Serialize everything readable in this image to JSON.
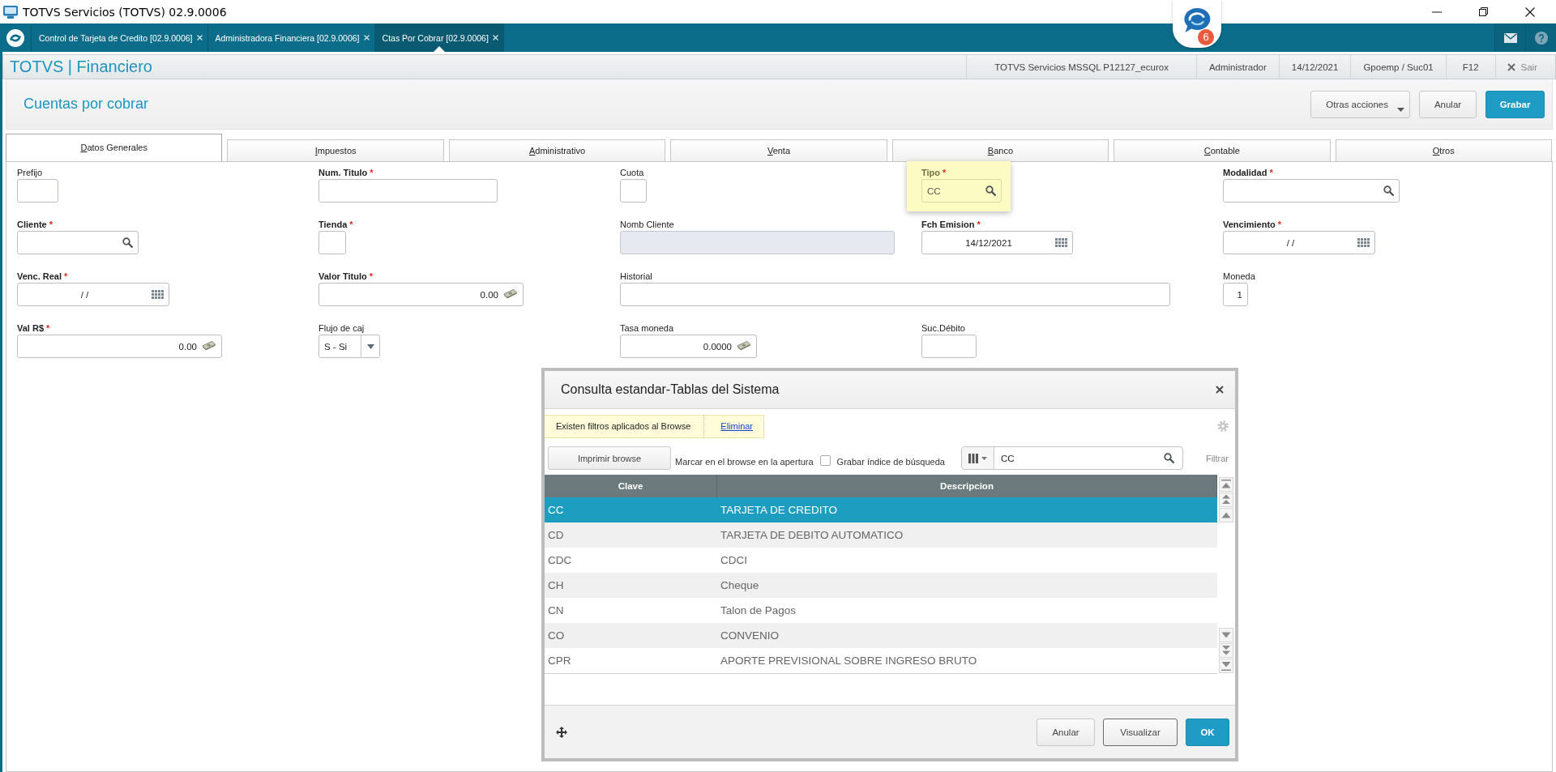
{
  "window": {
    "title": "TOTVS Servicios (TOTVS) 02.9.0006"
  },
  "app_tabs": [
    {
      "label": "Control de Tarjeta de Credito [02.9.0006]",
      "selected": false
    },
    {
      "label": "Administradora Financiera [02.9.0006]",
      "selected": false
    },
    {
      "label": "Ctas Por Cobrar [02.9.0006]",
      "selected": true
    }
  ],
  "chat": {
    "badge": "6"
  },
  "header": {
    "module": "TOTVS | Financiero",
    "environment": "TOTVS Servicios MSSQL P12127_ecurox",
    "user": "Administrador",
    "date": "14/12/2021",
    "branch": "Gpoemp / Suc01",
    "shortcut": "F12",
    "exit": "Sair"
  },
  "page": {
    "title": "Cuentas por cobrar",
    "actions": [
      {
        "label": "Otras acciones",
        "kind": "menu"
      },
      {
        "label": "Anular",
        "kind": "secondary"
      },
      {
        "label": "Grabar",
        "kind": "primary"
      }
    ]
  },
  "form_tabs": [
    {
      "label": "Datos Generales",
      "selected": true
    },
    {
      "label": "Impuestos",
      "selected": false
    },
    {
      "label": "Administrativo",
      "selected": false
    },
    {
      "label": "Venta",
      "selected": false
    },
    {
      "label": "Banco",
      "selected": false
    },
    {
      "label": "Contable",
      "selected": false
    },
    {
      "label": "Otros",
      "selected": false
    }
  ],
  "fields": [
    {
      "label": "Prefijo",
      "kind": "text",
      "disabled": false,
      "focused": false
    },
    {
      "label": "Num. Titulo",
      "required_mark": "*",
      "kind": "text",
      "disabled": false,
      "focused": false
    },
    {
      "label": "Cuota",
      "kind": "text",
      "disabled": false,
      "focused": false
    },
    {
      "label": "Tipo",
      "required_mark": "*",
      "kind": "lookup",
      "value": "CC",
      "disabled": false,
      "focused": true
    },
    {
      "label": "Modalidad",
      "required_mark": "*",
      "kind": "lookup",
      "disabled": false,
      "focused": false
    },
    {
      "label": "Cliente",
      "required_mark": "*",
      "kind": "lookup",
      "disabled": false,
      "focused": false
    },
    {
      "label": "Tienda",
      "required_mark": "*",
      "kind": "text",
      "disabled": false,
      "focused": false
    },
    {
      "label": "Nomb Cliente",
      "kind": "text",
      "disabled": true,
      "focused": false
    },
    {
      "label": "Fch Emision",
      "required_mark": "*",
      "kind": "date",
      "value": "14/12/2021",
      "disabled": false,
      "focused": false
    },
    {
      "label": "Vencimiento",
      "required_mark": "*",
      "kind": "date",
      "value": "/ /",
      "disabled": false,
      "focused": false
    },
    {
      "label": "Venc. Real",
      "required_mark": "*",
      "kind": "date",
      "value": "/ /",
      "disabled": false,
      "focused": false
    },
    {
      "label": "Valor Titulo",
      "required_mark": "*",
      "kind": "money",
      "value": "0.00",
      "disabled": false,
      "focused": false
    },
    {
      "label": "Historial",
      "kind": "memo",
      "disabled": false,
      "focused": false
    },
    {
      "label": "Moneda",
      "kind": "number",
      "value": "1",
      "disabled": false,
      "focused": false
    },
    {
      "label": "Val R$",
      "required_mark": "*",
      "kind": "money",
      "value": "0.00",
      "disabled": false,
      "focused": false
    },
    {
      "label": "Flujo de caj",
      "kind": "select",
      "value": "S - Si",
      "disabled": false,
      "focused": false
    },
    {
      "label": "Tasa moneda",
      "kind": "money",
      "value": "0.0000",
      "disabled": false,
      "focused": false
    },
    {
      "label": "Suc.Débito",
      "kind": "text",
      "disabled": false,
      "focused": false
    }
  ],
  "lookup_dialog": {
    "title": "Consulta estandar-Tablas del Sistema",
    "filter_notice": "Existen filtros aplicados al Browse",
    "filter_link": "Eliminar",
    "print_button": "Imprimir browse",
    "browse_option": "Marcar en el browse en la apertura",
    "save_index": {
      "label": "Grabar índice de búsqueda",
      "checked": false
    },
    "search": {
      "value": "CC"
    },
    "filter_button": "Filtrar",
    "table": {
      "columns": [
        "Clave",
        "Descripcion"
      ],
      "rows": [
        {
          "cells": [
            "CC",
            "TARJETA DE CREDITO"
          ],
          "selected": true
        },
        {
          "cells": [
            "CD",
            "TARJETA DE DEBITO AUTOMATICO"
          ],
          "selected": false
        },
        {
          "cells": [
            "CDC",
            "CDCI"
          ],
          "selected": false
        },
        {
          "cells": [
            "CH",
            "Cheque"
          ],
          "selected": false
        },
        {
          "cells": [
            "CN",
            "Talon de Pagos"
          ],
          "selected": false
        },
        {
          "cells": [
            "CO",
            "CONVENIO"
          ],
          "selected": false
        },
        {
          "cells": [
            "CPR",
            "APORTE PREVISIONAL SOBRE INGRESO BRUTO"
          ],
          "selected": false
        }
      ]
    },
    "buttons": [
      {
        "label": "Anular",
        "kind": "secondary"
      },
      {
        "label": "Visualizar",
        "kind": "outlined"
      },
      {
        "label": "OK",
        "kind": "primary"
      }
    ]
  }
}
